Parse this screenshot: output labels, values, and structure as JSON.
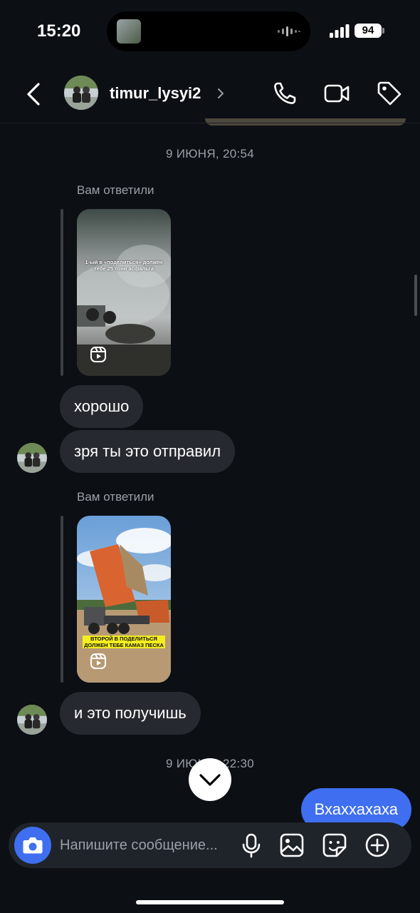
{
  "status_bar": {
    "time": "15:20",
    "battery": "94"
  },
  "header": {
    "username": "timur_lysyi2",
    "icons": [
      "back-arrow-icon",
      "chevron-right-icon",
      "phone-icon",
      "video-camera-icon",
      "tag-icon"
    ]
  },
  "messages": {
    "timestamp_1": "9 ИЮНЯ, 20:54",
    "reply_label_1": "Вам ответили",
    "reel_1_caption": "1-ый в «поделиться» должен тебе 25 тонн асфальта",
    "msg_1": "хорошо",
    "msg_2": "зря ты это отправил",
    "reply_label_2": "Вам ответили",
    "reel_2_caption": "ВТОРОЙ В ПОДЕЛИТЬСЯ ДОЛЖЕН ТЕБЕ КАМАЗ ПЕСКА",
    "msg_3": "и это получишь",
    "timestamp_2": "9 ИЮНЯ, 22:30",
    "msg_out_1": "Вхаххахаха"
  },
  "composer": {
    "placeholder": "Напишите сообщение...",
    "icons": [
      "camera-icon",
      "microphone-icon",
      "gallery-icon",
      "sticker-icon",
      "plus-icon"
    ]
  },
  "colors": {
    "background": "#0c0f14",
    "incoming_bubble": "#262930",
    "outgoing_bubble": "#3f6ff0",
    "secondary_text": "#9aa0a8",
    "reel_2_caption_bg": "#f4ee1f"
  }
}
